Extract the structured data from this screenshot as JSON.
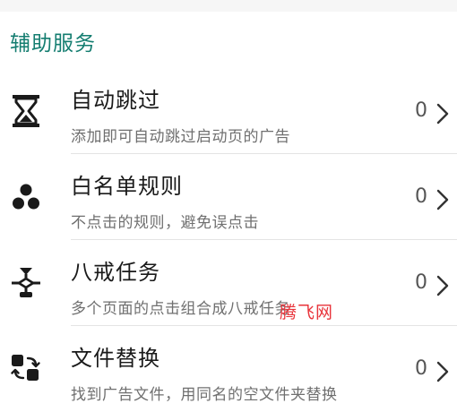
{
  "section": {
    "title": "辅助服务"
  },
  "items": [
    {
      "icon": "hourglass-icon",
      "title": "自动跳过",
      "desc": "添加即可自动跳过启动页的广告",
      "count": "0"
    },
    {
      "icon": "three-dots-icon",
      "title": "白名单规则",
      "desc": "不点击的规则，避免误点击",
      "count": "0"
    },
    {
      "icon": "flow-chart-icon",
      "title": "八戒任务",
      "desc": "多个页面的点击组合成八戒任务",
      "count": "0"
    },
    {
      "icon": "swap-icon",
      "title": "文件替换",
      "desc": "找到广告文件，用同名的空文件夹替换",
      "count": "0"
    }
  ],
  "watermark": "腾飞网",
  "colors": {
    "accent": "#147d70",
    "watermark": "#e8333a"
  }
}
